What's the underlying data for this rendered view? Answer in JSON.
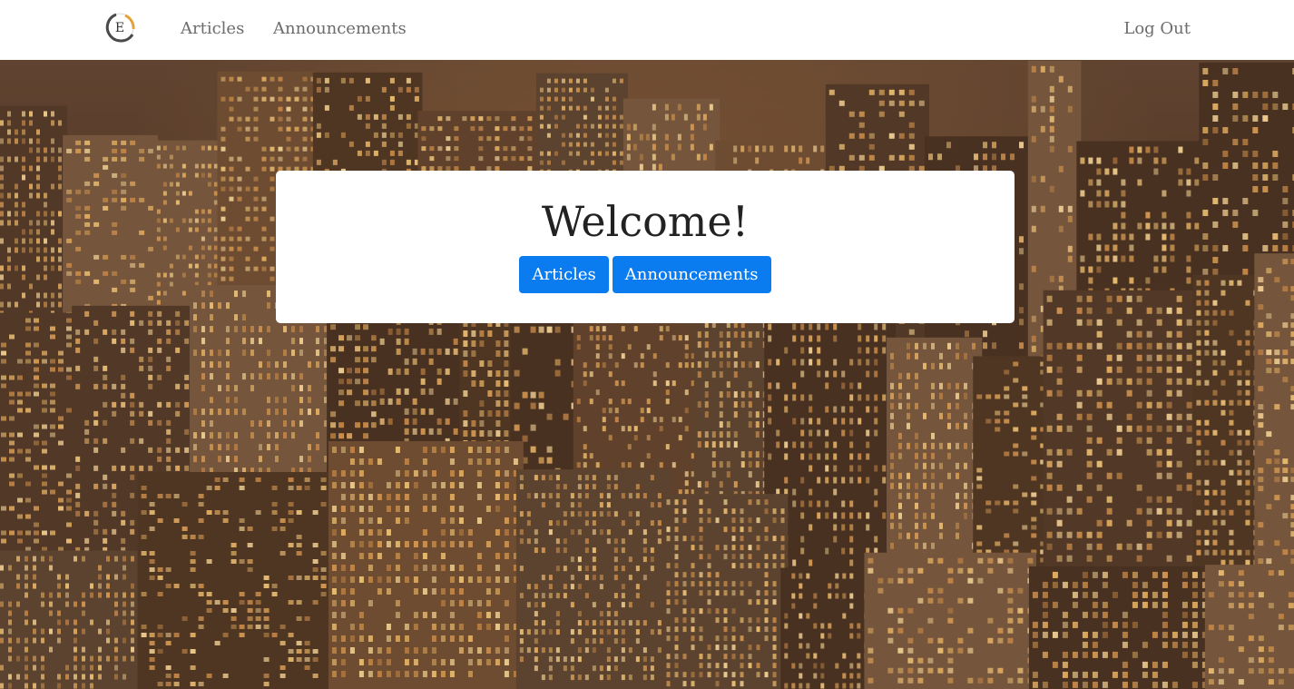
{
  "nav": {
    "logo_letter": "E",
    "links": [
      "Articles",
      "Announcements"
    ],
    "logout_label": "Log Out"
  },
  "hero": {
    "background": "city-skyline-night-photo"
  },
  "card": {
    "title": "Welcome!",
    "buttons": [
      "Articles",
      "Announcements"
    ]
  },
  "colors": {
    "primary_button": "#0a7cf0",
    "nav_text": "#6c6c6c",
    "logo_gold": "#e3a33a"
  }
}
